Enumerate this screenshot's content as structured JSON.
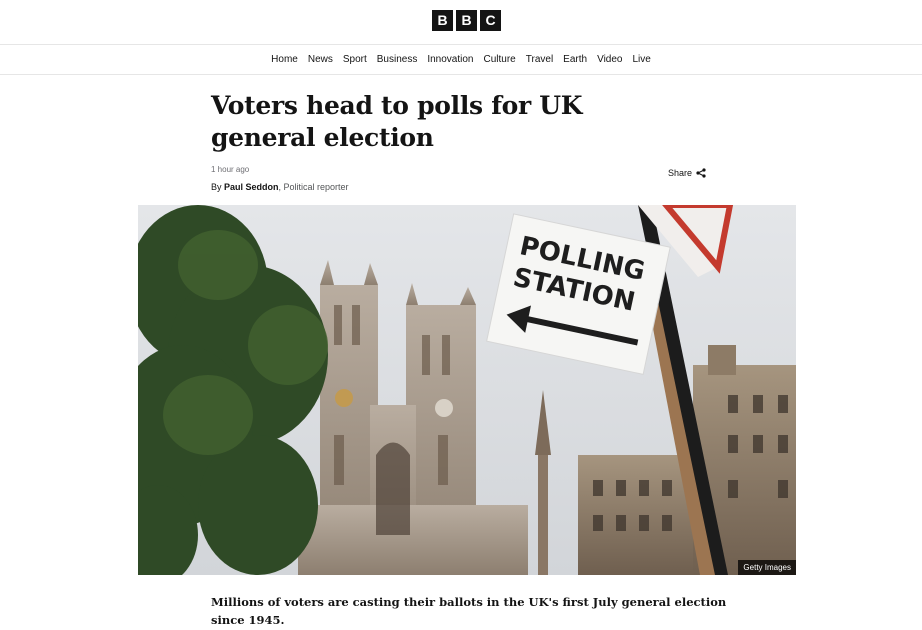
{
  "logo": {
    "letters": [
      "B",
      "B",
      "C"
    ]
  },
  "nav": {
    "items": [
      {
        "label": "Home"
      },
      {
        "label": "News"
      },
      {
        "label": "Sport"
      },
      {
        "label": "Business"
      },
      {
        "label": "Innovation"
      },
      {
        "label": "Culture"
      },
      {
        "label": "Travel"
      },
      {
        "label": "Earth"
      },
      {
        "label": "Video"
      },
      {
        "label": "Live"
      }
    ]
  },
  "article": {
    "headline": "Voters head to polls for UK general election",
    "timestamp": "1 hour ago",
    "byline_prefix": "By ",
    "author": "Paul Seddon",
    "role": ", Political reporter",
    "share_label": "Share",
    "image": {
      "sign_line1": "POLLING",
      "sign_line2": "STATION",
      "credit": "Getty Images"
    },
    "summary": "Millions of voters are casting their ballots in the UK's first July general election since 1945."
  },
  "colors": {
    "text": "#141414",
    "muted": "#6e6e73",
    "logo_bg": "#141414"
  },
  "icons": {
    "share": "share-icon"
  }
}
